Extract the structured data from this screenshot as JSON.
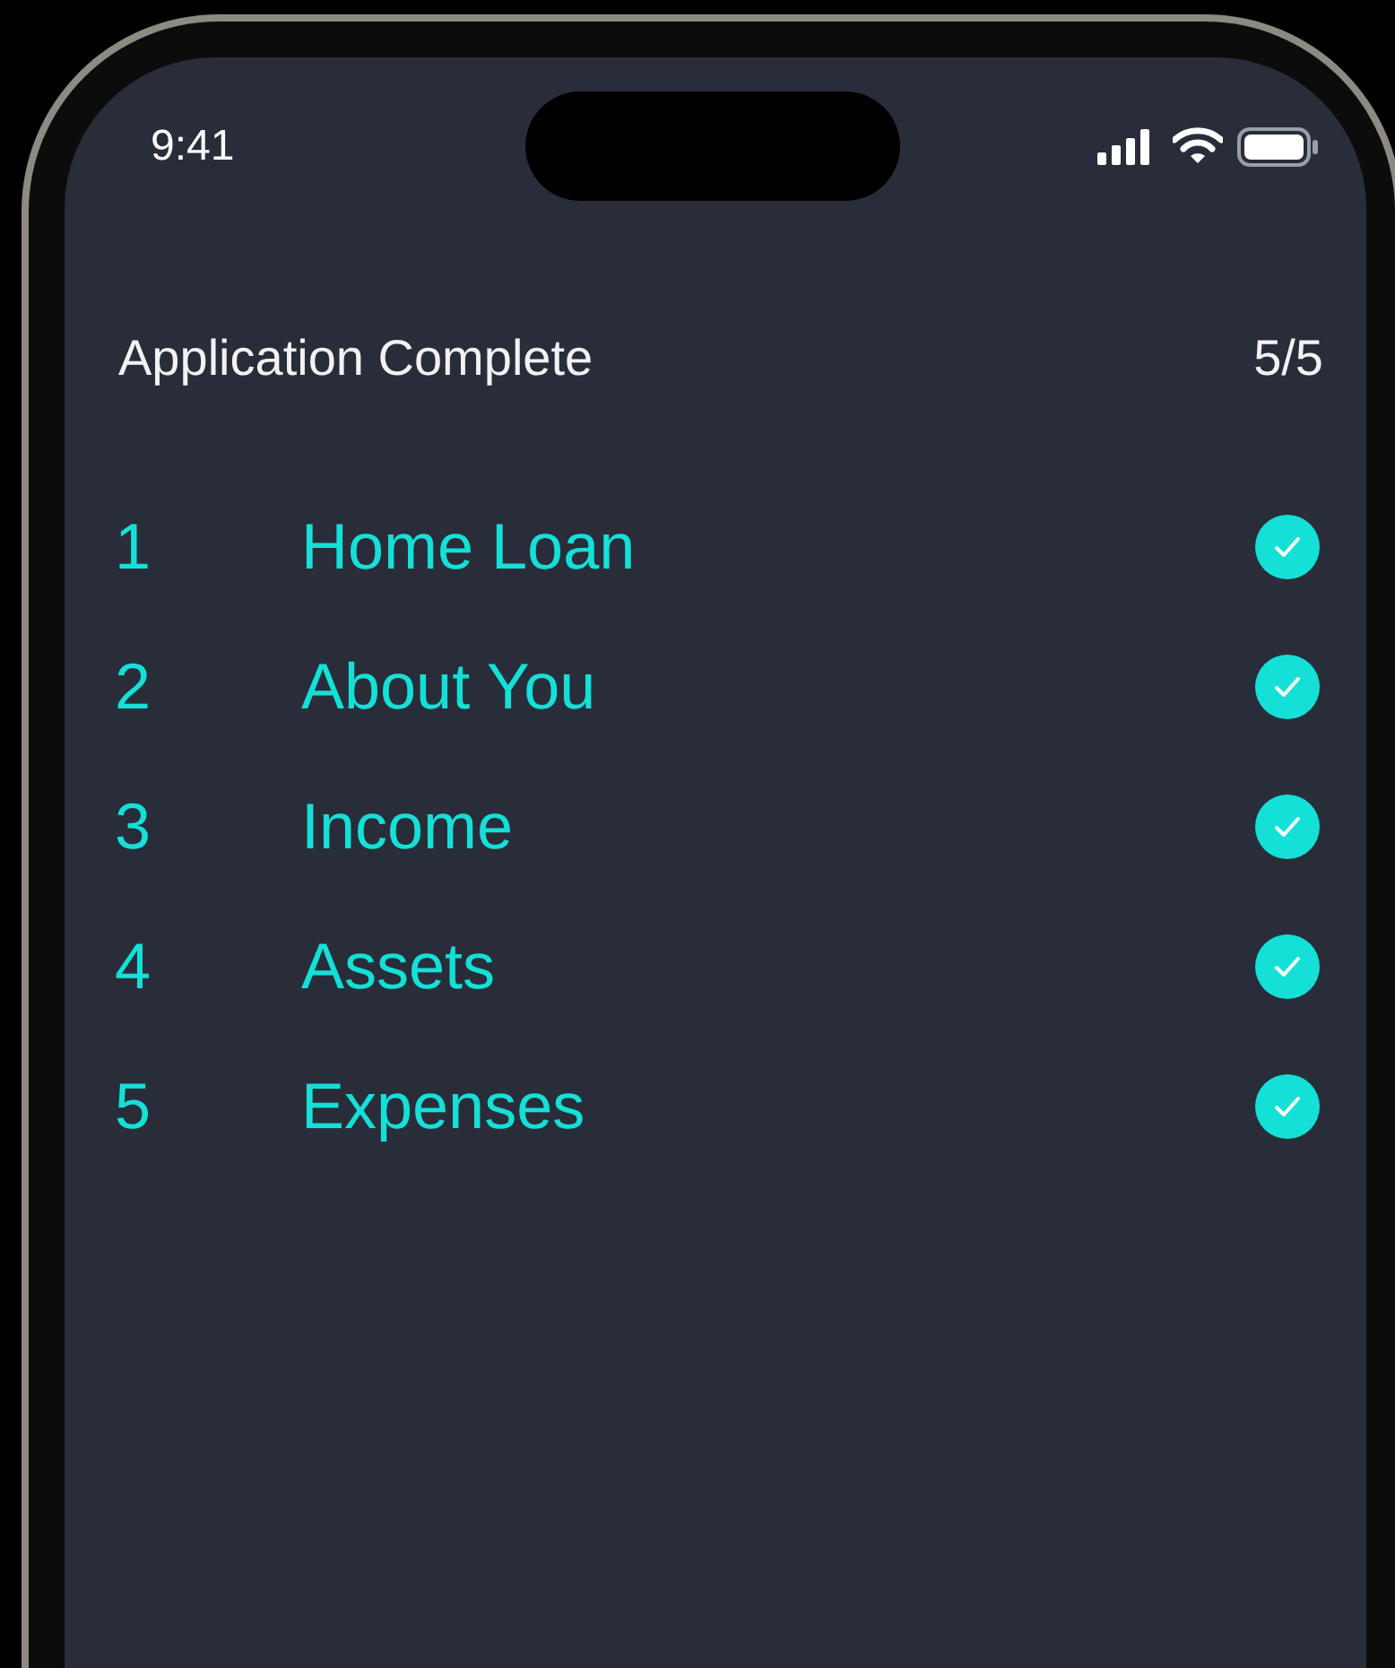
{
  "status_bar": {
    "time": "9:41"
  },
  "header": {
    "title": "Application Complete",
    "progress": "5/5"
  },
  "steps": [
    {
      "number": "1",
      "label": "Home Loan",
      "checked": true
    },
    {
      "number": "2",
      "label": "About You",
      "checked": true
    },
    {
      "number": "3",
      "label": "Income",
      "checked": true
    },
    {
      "number": "4",
      "label": "Assets",
      "checked": true
    },
    {
      "number": "5",
      "label": "Expenses",
      "checked": true
    }
  ]
}
